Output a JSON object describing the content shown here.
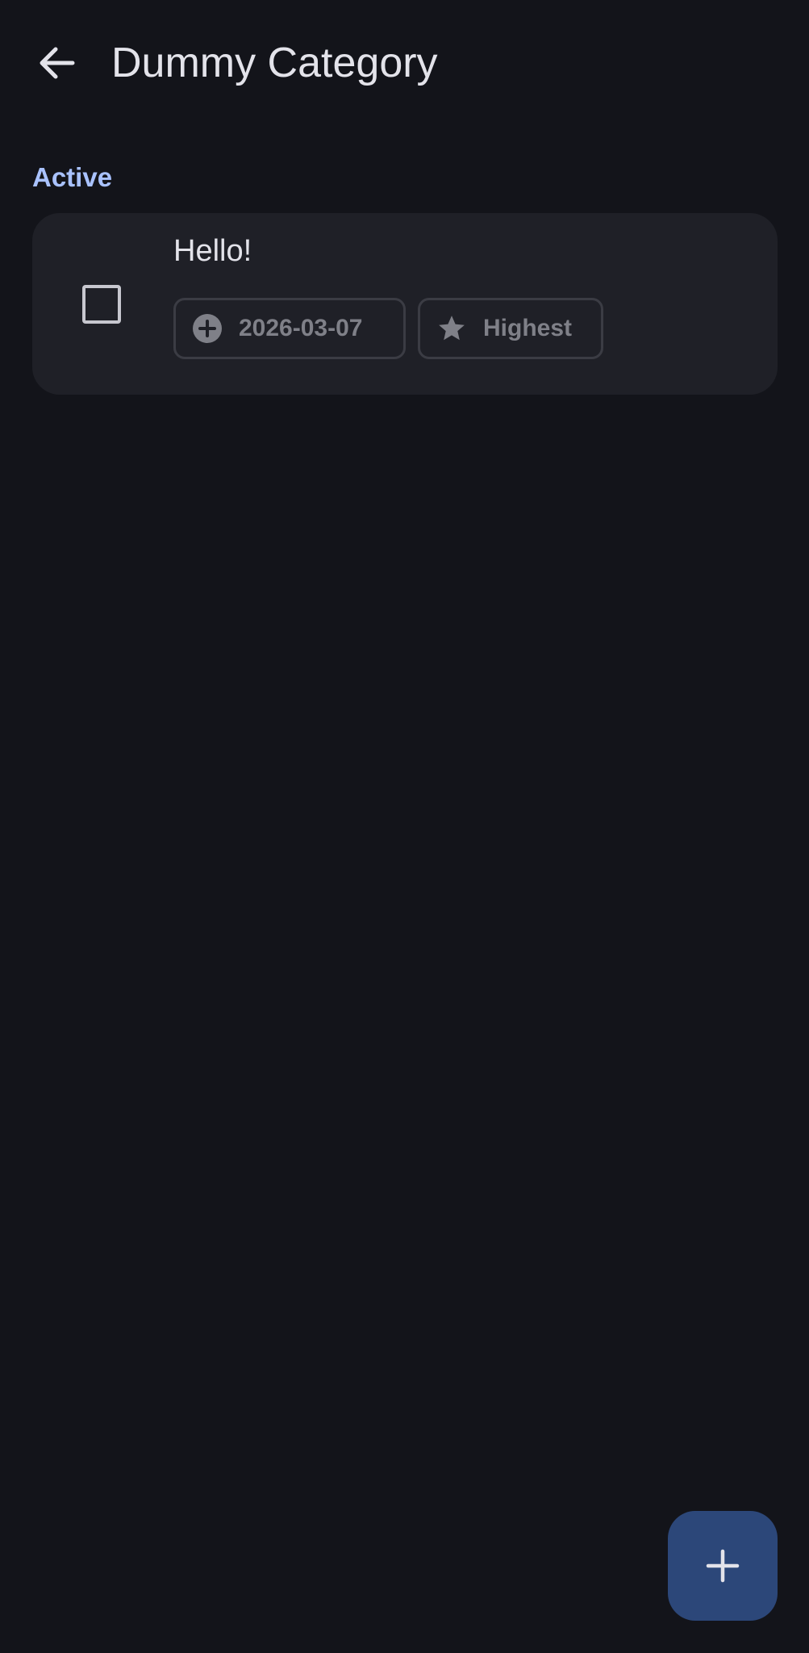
{
  "header": {
    "back_icon": "arrow-left-icon",
    "title": "Dummy Category"
  },
  "section": {
    "label": "Active"
  },
  "tasks": [
    {
      "title": "Hello!",
      "checked": false,
      "date_chip": {
        "icon": "add-circle-icon",
        "label": "2026-03-07"
      },
      "priority_chip": {
        "icon": "star-icon",
        "label": "Highest"
      }
    }
  ],
  "fab": {
    "icon": "plus-icon"
  },
  "colors": {
    "background": "#13141a",
    "card": "#1f2027",
    "accent_label": "#a9c2ff",
    "fab": "#2c4779",
    "chip_text": "#7f8088",
    "text_primary": "#e3e3ea"
  }
}
